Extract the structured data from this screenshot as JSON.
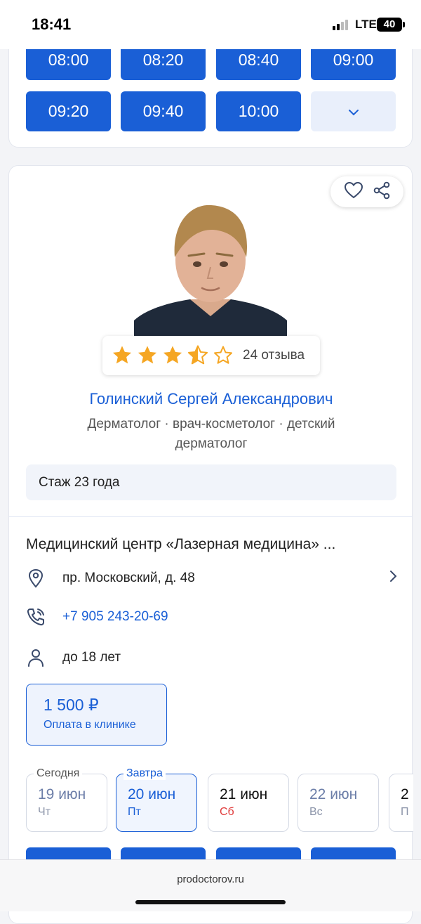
{
  "status": {
    "time": "18:41",
    "network": "LTE",
    "battery": "40"
  },
  "slots": [
    "08:00",
    "08:20",
    "08:40",
    "09:00",
    "09:20",
    "09:40",
    "10:00"
  ],
  "icons": {
    "more": "chevron-down-icon",
    "favorite": "heart-icon",
    "share": "share-icon",
    "location": "map-pin-icon",
    "phone": "phone-icon",
    "age": "person-icon",
    "arrow": "chevron-right-icon"
  },
  "doctor": {
    "rating": 3.5,
    "reviews": "24 отзыва",
    "name": "Голинский Сергей Александрович",
    "specialty": "Дерматолог · врач-косметолог · детский дерматолог",
    "experience": "Стаж 23 года"
  },
  "clinic": {
    "name": "Медицинский центр «Лазерная медицина» ...",
    "address": "пр. Московский, д. 48",
    "phone": "+7 905 243-20-69",
    "age": "до 18 лет"
  },
  "price": {
    "value": "1 500 ₽",
    "note": "Оплата в клинике"
  },
  "days": [
    {
      "label": "Сегодня",
      "date": "19 июн",
      "weekday": "Чт"
    },
    {
      "label": "Завтра",
      "date": "20 июн",
      "weekday": "Пт"
    },
    {
      "label": "",
      "date": "21 июн",
      "weekday": "Сб"
    },
    {
      "label": "",
      "date": "22 июн",
      "weekday": "Вс"
    },
    {
      "label": "",
      "date": "2",
      "weekday": "П"
    }
  ],
  "colors": {
    "accent": "#1a5fd6",
    "star": "#f5a623",
    "weekend": "#e03a3a"
  },
  "browser": {
    "url": "prodoctorov.ru"
  }
}
